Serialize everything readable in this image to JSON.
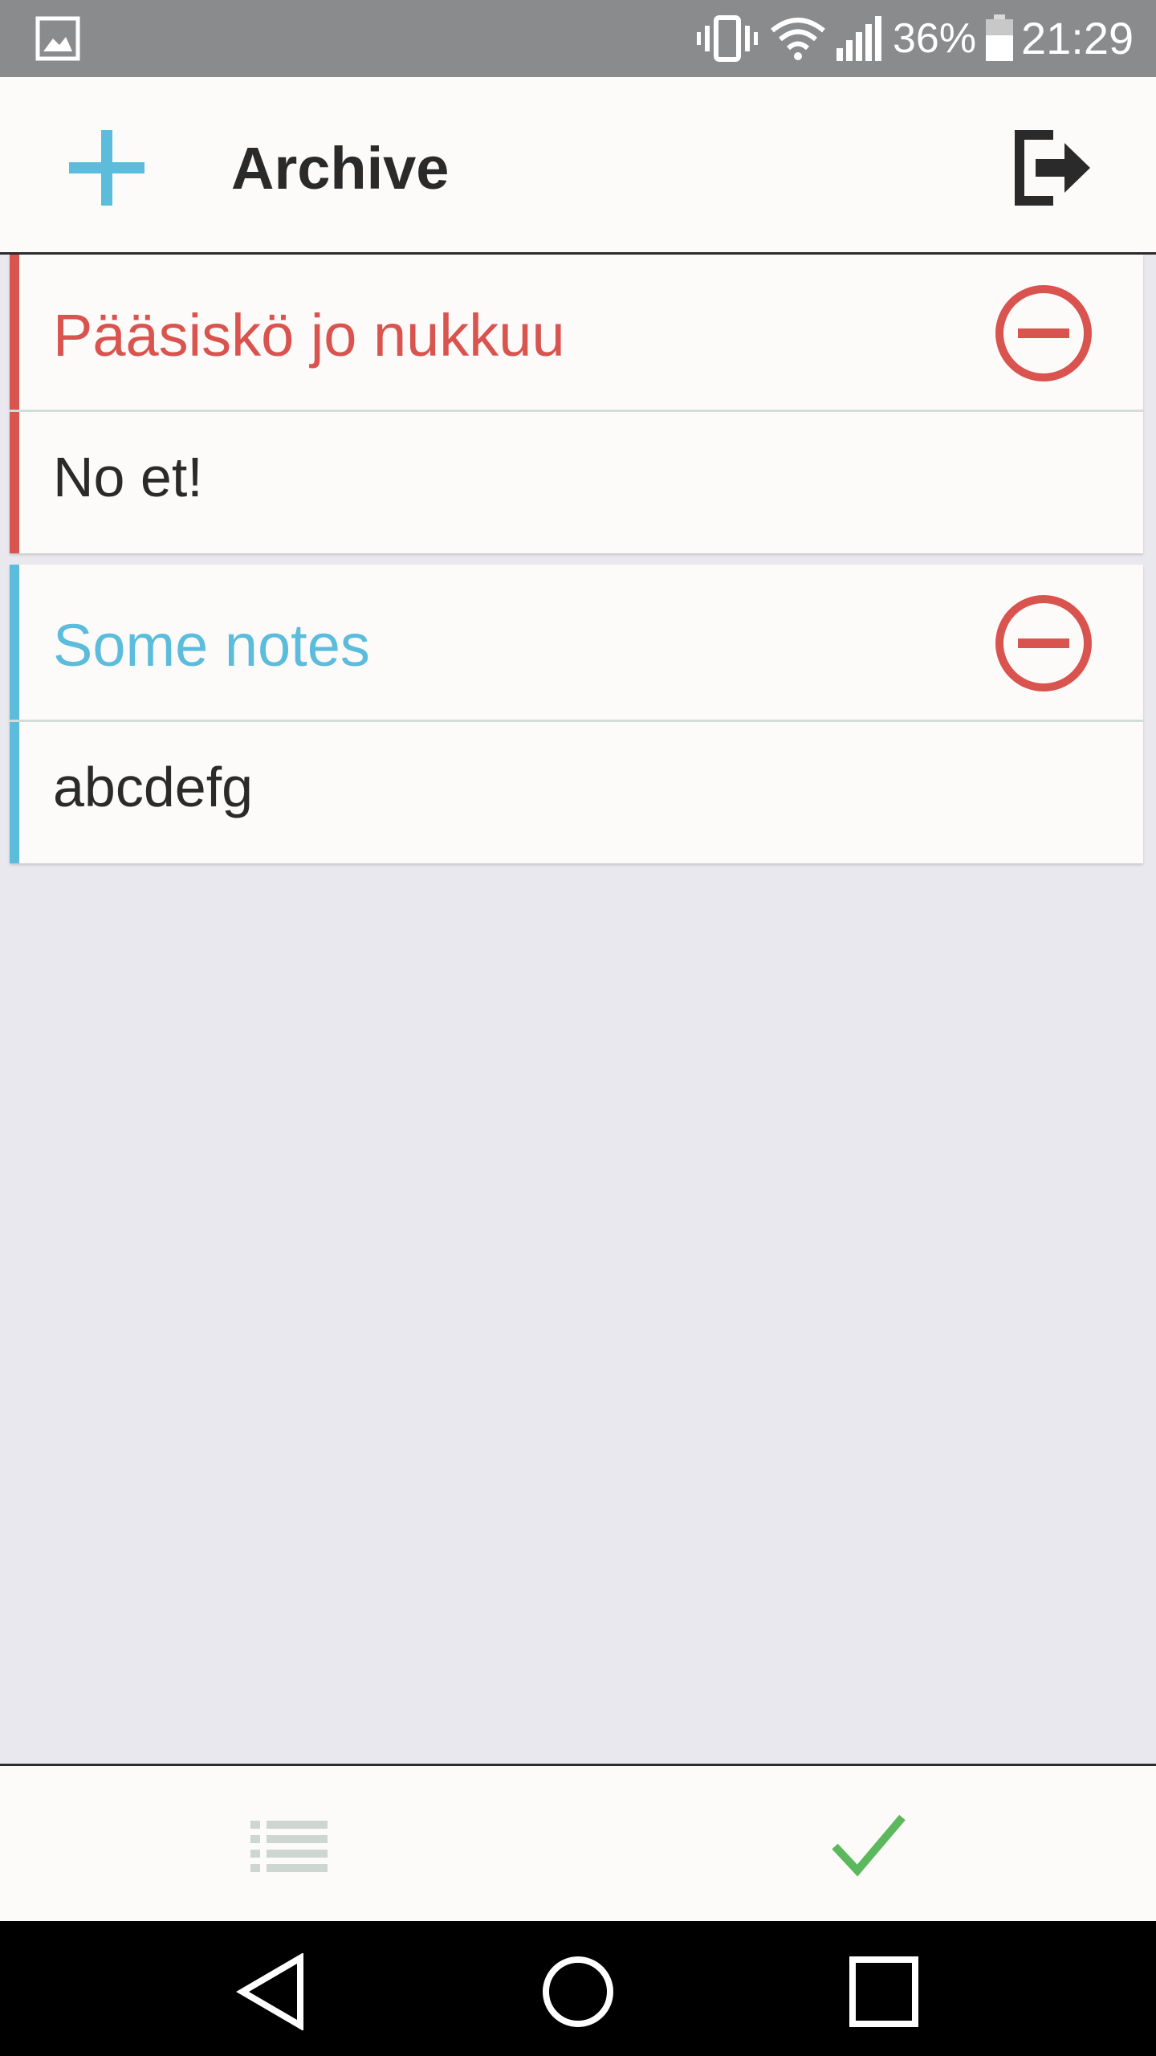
{
  "status_bar": {
    "battery_percent": "36%",
    "time": "21:29",
    "icons": [
      "gallery-icon",
      "vibrate-icon",
      "wifi-icon",
      "signal-icon",
      "battery-icon"
    ]
  },
  "app_bar": {
    "title": "Archive",
    "add_icon": "plus-icon",
    "logout_icon": "logout-icon",
    "accent_color": "#5bbcdc"
  },
  "notes": [
    {
      "title": "Pääsiskö jo nukkuu",
      "body": "No et!",
      "color": "#d9534f"
    },
    {
      "title": "Some notes",
      "body": "abcdefg",
      "color": "#5bbcdc"
    }
  ],
  "remove_icon": "minus-circle-icon",
  "remove_color": "#d9534f",
  "bottom_bar": {
    "list_icon": "list-icon",
    "done_icon": "checkmark-icon",
    "done_color": "#5cb85c"
  },
  "nav_bar": {
    "icons": [
      "back-icon",
      "home-icon",
      "recent-apps-icon"
    ]
  }
}
